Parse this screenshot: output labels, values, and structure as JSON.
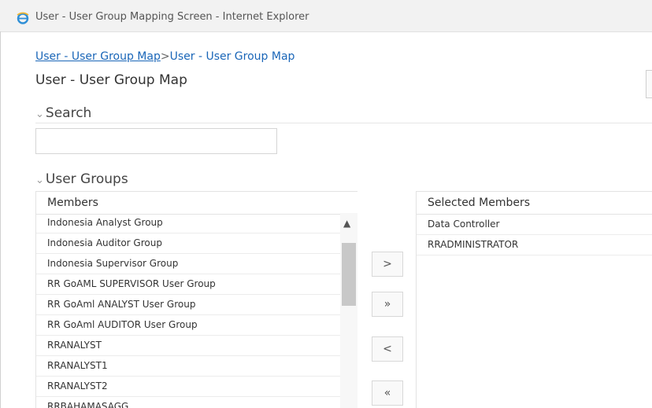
{
  "window": {
    "title": "User - User Group Mapping Screen - Internet Explorer",
    "icon": "internet-explorer-icon"
  },
  "breadcrumb": {
    "link": "User - User Group Map",
    "separator": ">",
    "current": "User - User Group Map"
  },
  "page_title": "User - User Group Map",
  "search": {
    "section_label": "Search",
    "value": "",
    "placeholder": ""
  },
  "user_groups": {
    "section_label": "User Groups",
    "members_header": "Members",
    "members": [
      "Indonesia Analyst Group",
      "Indonesia Auditor Group",
      "Indonesia Supervisor Group",
      "RR GoAML SUPERVISOR User Group",
      "RR GoAml ANALYST User Group",
      "RR GoAml AUDITOR User Group",
      "RRANALYST",
      "RRANALYST1",
      "RRANALYST2",
      "RRBAHAMASAGG"
    ],
    "selected_header": "Selected Members",
    "selected": [
      "Data Controller",
      "RRADMINISTRATOR"
    ]
  },
  "buttons": {
    "move_right": ">",
    "move_all_right": "»",
    "move_left": "<",
    "move_all_left": "«"
  },
  "colors": {
    "link": "#1a66b8",
    "titlebar": "#f2f2f2",
    "thumb": "#c8c8c8"
  }
}
